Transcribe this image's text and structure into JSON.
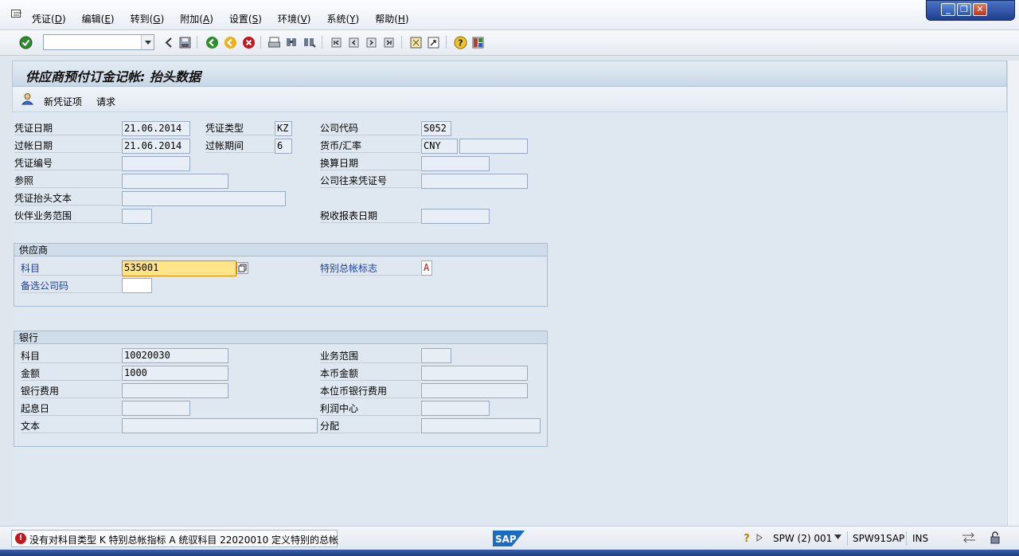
{
  "menu": [
    {
      "label": "凭证(D)",
      "text": "凭证(",
      "key": "D",
      "end": ")"
    },
    {
      "label": "编辑(E)",
      "text": "编辑(",
      "key": "E",
      "end": ")"
    },
    {
      "label": "转到(G)",
      "text": "转到(",
      "key": "G",
      "end": ")"
    },
    {
      "label": "附加(A)",
      "text": "附加(",
      "key": "A",
      "end": ")"
    },
    {
      "label": "设置(S)",
      "text": "设置(",
      "key": "S",
      "end": ")"
    },
    {
      "label": "环境(V)",
      "text": "环境(",
      "key": "V",
      "end": ")"
    },
    {
      "label": "系统(Y)",
      "text": "系统(",
      "key": "Y",
      "end": ")"
    },
    {
      "label": "帮助(H)",
      "text": "帮助(",
      "key": "H",
      "end": ")"
    }
  ],
  "command_field": {
    "value": ""
  },
  "title": "供应商预付订金记帐: 抬头数据",
  "app_toolbar": {
    "new_item": "新凭证项",
    "request": "请求"
  },
  "header": {
    "doc_date_label": "凭证日期",
    "doc_date": "21.06.2014",
    "doc_type_label": "凭证类型",
    "doc_type": "KZ",
    "company_code_label": "公司代码",
    "company_code": "S052",
    "posting_date_label": "过帐日期",
    "posting_date": "21.06.2014",
    "period_label": "过帐期间",
    "period": "6",
    "currency_label": "货币/汇率",
    "currency": "CNY",
    "exchange_rate": "",
    "doc_number_label": "凭证编号",
    "doc_number": "",
    "translation_date_label": "换算日期",
    "translation_date": "",
    "reference_label": "参照",
    "reference": "",
    "intercompany_label": "公司往来凭证号",
    "intercompany": "",
    "header_text_label": "凭证抬头文本",
    "header_text": "",
    "partner_ba_label": "伙伴业务范围",
    "partner_ba": "",
    "tax_date_label": "税收报表日期",
    "tax_date": ""
  },
  "vendor": {
    "group_title": "供应商",
    "account_label": "科目",
    "account": "535001",
    "alt_cc_label": "备选公司码",
    "alt_cc": "",
    "special_gl_label": "特别总帐标志",
    "special_gl": "A"
  },
  "bank": {
    "group_title": "银行",
    "account_label": "科目",
    "account": "10020030",
    "amount_label": "金额",
    "amount": "1000",
    "bank_charges_label": "银行费用",
    "bank_charges": "",
    "value_date_label": "起息日",
    "value_date": "",
    "text_label": "文本",
    "text": "",
    "business_area_label": "业务范围",
    "business_area": "",
    "local_amount_label": "本币金额",
    "local_amount": "",
    "local_bank_charges_label": "本位币银行费用",
    "local_bank_charges": "",
    "profit_center_label": "利润中心",
    "profit_center": "",
    "assignment_label": "分配",
    "assignment": ""
  },
  "status": {
    "message": "没有对科目类型 K 特别总帐指标 A 统驭科目 22020010 定义特别的总帐",
    "system": "SPW (2) 001",
    "server": "SPW91SAP",
    "mode": "INS"
  },
  "colors": {
    "focus_field": "#ffe48a",
    "error": "#c4161c",
    "link_label": "#1a3f9e"
  }
}
